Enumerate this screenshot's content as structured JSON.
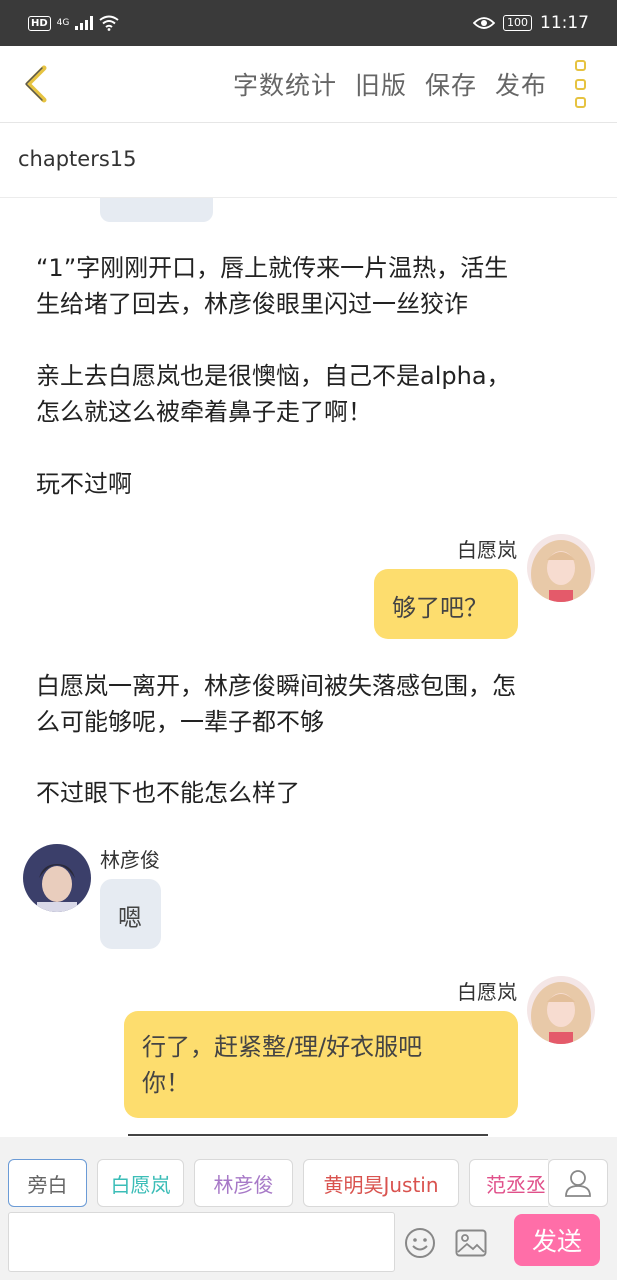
{
  "status_bar": {
    "network": "4G",
    "battery": "100",
    "time": "11:17"
  },
  "toolbar": {
    "actions": [
      "字数统计",
      "旧版",
      "保存",
      "发布"
    ]
  },
  "chapter_title": "chapters15",
  "messages": [
    {
      "type": "narration",
      "lines": [
        "“1”字刚刚开口，唇上就传来一片温热，活生",
        "生给堵了回去，林彦俊眼里闪过一丝狡诈"
      ]
    },
    {
      "type": "narration",
      "lines": [
        "亲上去白愿岚也是很懊恼，自己不是alpha，",
        "怎么就这么被牵着鼻子走了啊！"
      ]
    },
    {
      "type": "narration",
      "lines": [
        "玩不过啊"
      ]
    },
    {
      "type": "dialogue",
      "speaker": "白愿岚",
      "side": "right",
      "lines": [
        "够了吧？"
      ]
    },
    {
      "type": "narration",
      "lines": [
        "白愿岚一离开，林彦俊瞬间被失落感包围，怎",
        "么可能够呢，一辈子都不够"
      ]
    },
    {
      "type": "narration",
      "lines": [
        "不过眼下也不能怎么样了"
      ]
    },
    {
      "type": "dialogue",
      "speaker": "林彦俊",
      "side": "left",
      "lines": [
        "嗯"
      ]
    },
    {
      "type": "dialogue",
      "speaker": "白愿岚",
      "side": "right",
      "lines": [
        "行了，赶紧整/理/好衣服吧",
        "你！"
      ]
    }
  ],
  "roles": [
    {
      "label": "旁白",
      "color": "#666666",
      "active": true
    },
    {
      "label": "白愿岚",
      "color": "#3bbdb7",
      "active": false
    },
    {
      "label": "林彦俊",
      "color": "#a779c7",
      "active": false
    },
    {
      "label": "黄明昊Justin",
      "color": "#d9534f",
      "active": false
    },
    {
      "label": "范丞丞",
      "color": "#e0508a",
      "active": false
    }
  ],
  "input": {
    "placeholder": ""
  },
  "send_label": "发送",
  "icons": [
    "back-chevron-icon",
    "more-menu-icon",
    "contact-icon",
    "emoji-icon",
    "image-icon"
  ]
}
